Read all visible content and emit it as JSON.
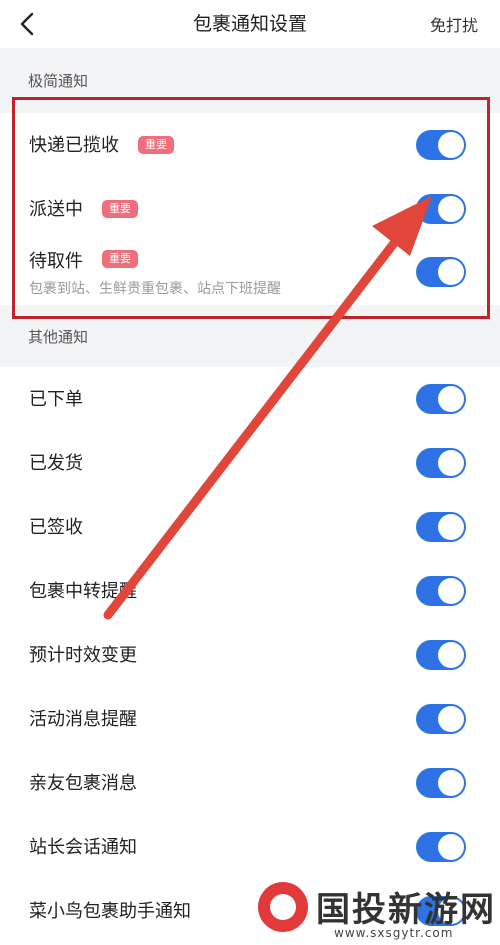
{
  "header": {
    "title": "包裹通知设置",
    "action": "免打扰",
    "back_icon": "chevron-left-icon"
  },
  "sections": {
    "simple": {
      "title": "极简通知"
    },
    "other": {
      "title": "其他通知"
    }
  },
  "simple_items": [
    {
      "label": "快递已揽收",
      "tag": "重要",
      "enabled": true
    },
    {
      "label": "派送中",
      "tag": "重要",
      "enabled": true
    },
    {
      "label": "待取件",
      "tag": "重要",
      "description": "包裹到站、生鲜贵重包裹、站点下班提醒",
      "enabled": true
    }
  ],
  "other_items": [
    {
      "label": "已下单",
      "enabled": true
    },
    {
      "label": "已发货",
      "enabled": true
    },
    {
      "label": "已签收",
      "enabled": true
    },
    {
      "label": "包裹中转提醒",
      "enabled": true
    },
    {
      "label": "预计时效变更",
      "enabled": true
    },
    {
      "label": "活动消息提醒",
      "enabled": true
    },
    {
      "label": "亲友包裹消息",
      "enabled": true
    },
    {
      "label": "站长会话通知",
      "enabled": true
    },
    {
      "label": "菜小鸟包裹助手通知",
      "enabled": true
    }
  ],
  "watermark": {
    "text": "国投新游网",
    "url": "www.sxsgytr.com"
  },
  "colors": {
    "toggle_on": "#2e73e6",
    "tag": "#f06d7b",
    "highlight_box": "#c0232c",
    "annotation_arrow": "#e0463a"
  }
}
